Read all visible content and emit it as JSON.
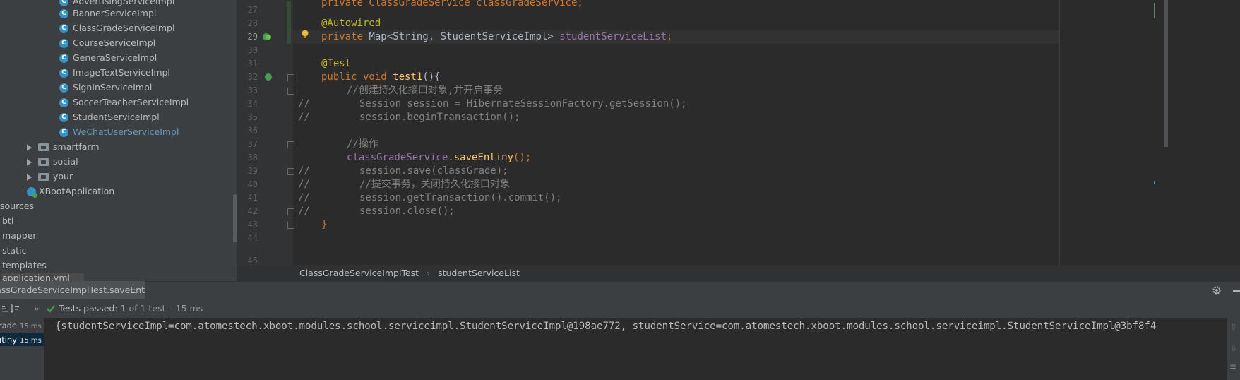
{
  "project_tree": {
    "class_items": [
      "AdvertisingServiceImpl",
      "BannerServiceImpl",
      "ClassGradeServiceImpl",
      "CourseServiceImpl",
      "GeneraServiceImpl",
      "ImageTextServiceImpl",
      "SignInServiceImpl",
      "SoccerTeacherServiceImpl",
      "StudentServiceImpl",
      "WeChatUserServiceImpl"
    ],
    "packages": [
      "smartfarm",
      "social",
      "your"
    ],
    "app_class": "XBootApplication",
    "resources_label": "sources",
    "resource_folders": [
      "btl",
      "mapper",
      "static",
      "templates"
    ],
    "resource_file": "application.yml"
  },
  "editor": {
    "line_numbers": [
      "27",
      "28",
      "29",
      "30",
      "31",
      "32",
      "33",
      "34",
      "35",
      "36",
      "37",
      "38",
      "39",
      "40",
      "41",
      "42",
      "43",
      "44",
      "45"
    ],
    "line27_partial": "private ClassGradeService classGradeService;",
    "annotation_autowired": "@Autowired",
    "field_line": {
      "kw": "private",
      "type": "Map<String, StudentServiceImpl>",
      "name": "studentServiceList",
      "end": ";"
    },
    "annotation_test": "@Test",
    "method_line": {
      "kw": "public void",
      "name": "test1",
      "end": "(){"
    },
    "comment_create": "//创建持久化接口对象,并开启事务",
    "commented_34": "Session session = HibernateSessionFactory.getSession();",
    "commented_35": "session.beginTransaction();",
    "comment_op": "//操作",
    "call_line": {
      "field": "classGradeService",
      "dot": ".",
      "method": "saveEntiny",
      "end": "();"
    },
    "commented_39": "session.save(classGrade);",
    "commented_40": "//提交事务，关闭持久化接口对象",
    "commented_41": "session.getTransaction().commit();",
    "commented_42": "session.close();",
    "close_brace": "}",
    "comment_marker": "//"
  },
  "breadcrumb": {
    "items": [
      "ClassGradeServiceImplTest",
      "studentServiceList"
    ],
    "separator": "›"
  },
  "run_panel": {
    "tab_label": "ClassGradeServiceImplTest.saveEntiny",
    "tab_close": "×",
    "status": "Tests passed:",
    "status_detail": "1 of 1 test – 15 ms",
    "test_rows": [
      {
        "name": "ClassGrade",
        "time": "15 ms"
      },
      {
        "name": "saveEntiny",
        "time": "15 ms"
      }
    ],
    "console_output": "{studentServiceImpl=com.atomestech.xboot.modules.school.serviceimpl.StudentServiceImpl@198ae772, studentService=com.atomestech.xboot.modules.school.serviceimpl.StudentServiceImpl@3bf8f4"
  },
  "colors": {
    "editor_bg": "#2b2b2b",
    "panel_bg": "#3c3f41",
    "keyword": "#cc7832",
    "annotation": "#bbb529",
    "field": "#9876aa",
    "method": "#ffc66d",
    "comment": "#808080",
    "class_icon": "#3592c4",
    "pass_green": "#499c54",
    "selected_blue": "#0d293e"
  },
  "icons": [
    "class-icon",
    "folder-icon",
    "expand-arrow-icon",
    "spring-app-icon",
    "run-gutter-icon",
    "bulb-icon",
    "gear-icon",
    "minimize-icon",
    "check-icon",
    "sort-icon"
  ]
}
